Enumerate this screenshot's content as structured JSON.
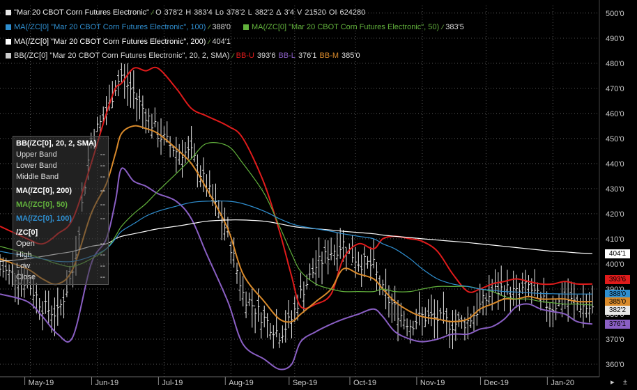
{
  "header": {
    "main": {
      "symbol": "\"Mar 20 CBOT Corn Futures Electronic\"",
      "open_label": "O",
      "open": "378'2",
      "high_label": "H",
      "high": "383'4",
      "low_label": "Lo",
      "low": "378'2",
      "last_label": "L",
      "last": "382'2",
      "change_label": "Δ",
      "change": "3'4",
      "volume_label": "V",
      "volume": "21520",
      "oi_label": "OI",
      "oi": "624280"
    },
    "ma100": {
      "label": "MA(/ZC[0] \"Mar 20 CBOT Corn Futures Electronic\", 100)",
      "value": "388'0"
    },
    "ma50": {
      "label": "MA(/ZC[0] \"Mar 20 CBOT Corn Futures Electronic\", 50)",
      "value": "383'5"
    },
    "ma200": {
      "label": "MA(/ZC[0] \"Mar 20 CBOT Corn Futures Electronic\", 200)",
      "value": "404'1"
    },
    "bb": {
      "label": "BB(/ZC[0] \"Mar 20 CBOT Corn Futures Electronic\", 20, 2, SMA)",
      "upper_label": "BB-U",
      "upper": "393'6",
      "lower_label": "BB-L",
      "lower": "376'1",
      "middle_label": "BB-M",
      "middle": "385'0"
    }
  },
  "data_panel": {
    "bb_title": "BB(/ZC[0], 20, 2, SMA)",
    "bb_rows": [
      "Upper Band",
      "Lower Band",
      "Middle Band"
    ],
    "ma200_title": "MA(/ZC[0], 200)",
    "ma50_title": "MA(/ZC[0], 50)",
    "ma100_title": "MA(/ZC[0], 100)",
    "price_title": "/ZC[0]",
    "price_rows": [
      "Open",
      "High",
      "Low",
      "Close"
    ],
    "placeholder": "--"
  },
  "colors": {
    "background": "#000000",
    "price_bars": "#e8e8e8",
    "bb_upper": "#e01b1b",
    "bb_lower": "#8a5fc4",
    "bb_middle": "#d98a2b",
    "ma200": "#ffffff",
    "ma50": "#62b23c",
    "ma100": "#2f8fd0",
    "grid": "#5a5a5a"
  },
  "axis_tags": {
    "ma200": "404'1",
    "bb_upper": "393'6",
    "ma100": "388'0",
    "bb_middle": "385'0",
    "last": "382'2",
    "bb_lower": "376'1"
  },
  "chart_data": {
    "type": "line",
    "title": "",
    "xlabel": "",
    "ylabel": "",
    "x_labels": [
      "May-19",
      "Jun-19",
      "Jul-19",
      "Aug-19",
      "Sep-19",
      "Oct-19",
      "Nov-19",
      "Dec-19",
      "Jan-20"
    ],
    "y_ticks": [
      360,
      370,
      380,
      390,
      400,
      410,
      420,
      430,
      440,
      450,
      460,
      470,
      480,
      490,
      500
    ],
    "y_tick_labels": [
      "360'0",
      "370'0",
      "380'0",
      "390'0",
      "400'0",
      "410'0",
      "420'0",
      "430'0",
      "440'0",
      "450'0",
      "460'0",
      "470'0",
      "480'0",
      "490'0",
      "500'0"
    ],
    "ylim": [
      355,
      503
    ],
    "grid": true,
    "x": [
      0,
      9,
      14,
      19,
      24,
      30,
      35,
      38,
      40,
      44,
      48,
      52,
      58,
      63,
      68,
      75,
      80,
      87,
      92,
      96,
      99,
      104,
      109,
      113,
      118,
      123,
      126,
      130,
      135,
      139,
      144,
      149,
      154,
      158,
      162,
      166,
      170,
      174,
      178,
      182,
      186,
      190,
      195
    ],
    "x_date_labels_at": [
      10,
      32,
      54,
      76,
      97,
      117,
      139,
      160,
      182
    ],
    "series": [
      {
        "name": "Upper Band",
        "values": [
          415,
          410,
          408,
          412,
          418,
          440,
          460,
          470,
          472,
          478,
          477,
          478,
          470,
          462,
          459,
          455,
          450,
          432,
          413,
          395,
          383,
          384,
          388,
          402,
          408,
          406,
          410,
          411,
          410,
          409,
          405,
          396,
          389,
          390,
          392,
          393,
          394,
          393,
          392,
          392,
          393,
          392,
          392
        ]
      },
      {
        "name": "Middle Band",
        "values": [
          402,
          398,
          394,
          392,
          398,
          420,
          432,
          444,
          452,
          455,
          454,
          452,
          446,
          440,
          430,
          414,
          396,
          385,
          378,
          377,
          380,
          385,
          390,
          398,
          396,
          394,
          390,
          385,
          381,
          379,
          378,
          377,
          378,
          382,
          384,
          386,
          386,
          387,
          386,
          386,
          386,
          385,
          385
        ]
      },
      {
        "name": "Lower Band",
        "values": [
          388,
          385,
          379,
          372,
          371,
          400,
          410,
          425,
          438,
          433,
          431,
          428,
          425,
          418,
          404,
          385,
          368,
          362,
          358,
          360,
          369,
          373,
          376,
          378,
          380,
          382,
          379,
          373,
          370,
          369,
          370,
          372,
          372,
          374,
          375,
          378,
          383,
          384,
          382,
          381,
          380,
          377,
          376
        ]
      },
      {
        "name": "MA(/ZC[0], 200)",
        "values": [
          401,
          402,
          403,
          404,
          405,
          407,
          408,
          410,
          411,
          412,
          413,
          414,
          415,
          416,
          417,
          417.5,
          417.5,
          417,
          416,
          415,
          414.5,
          414,
          413.5,
          413,
          412.5,
          412,
          411.5,
          411,
          410.5,
          410,
          409.5,
          409,
          408.5,
          408,
          407.5,
          407,
          406.5,
          406,
          405.5,
          405,
          404.8,
          404.4,
          404.1
        ]
      },
      {
        "name": "MA(/ZC[0], 50)",
        "values": [
          407,
          404,
          402,
          400,
          399,
          402,
          406,
          411,
          415,
          420,
          424,
          429,
          436,
          442,
          448,
          447,
          440,
          428,
          415,
          404,
          397,
          392,
          390,
          389,
          389,
          389,
          390,
          389,
          389,
          390,
          391,
          391,
          391,
          390,
          389,
          387,
          386,
          386,
          385,
          384.5,
          384,
          384,
          383.6
        ]
      },
      {
        "name": "MA(/ZC[0], 100)",
        "values": [
          405,
          403,
          402,
          401,
          401,
          403,
          406,
          410,
          413,
          416,
          419,
          421,
          423,
          424.5,
          425,
          425,
          424,
          421,
          418,
          416,
          415,
          414,
          413,
          412,
          411,
          410,
          408,
          406,
          402,
          398,
          394,
          392,
          391,
          390,
          389.5,
          389,
          388.8,
          388.5,
          388.2,
          388.1,
          388,
          388,
          388
        ]
      },
      {
        "name": "/ZC[0]",
        "values": [
          398,
          393,
          383,
          380,
          397,
          450,
          460,
          471,
          475,
          468,
          460,
          452,
          445,
          444,
          431,
          412,
          388,
          378,
          372,
          378,
          388,
          399,
          405,
          408,
          401,
          399,
          389,
          382,
          376,
          379,
          378,
          376,
          377,
          383,
          389,
          390,
          388,
          391,
          385,
          383,
          386,
          384,
          382
        ]
      }
    ],
    "last_close": "382'2"
  }
}
